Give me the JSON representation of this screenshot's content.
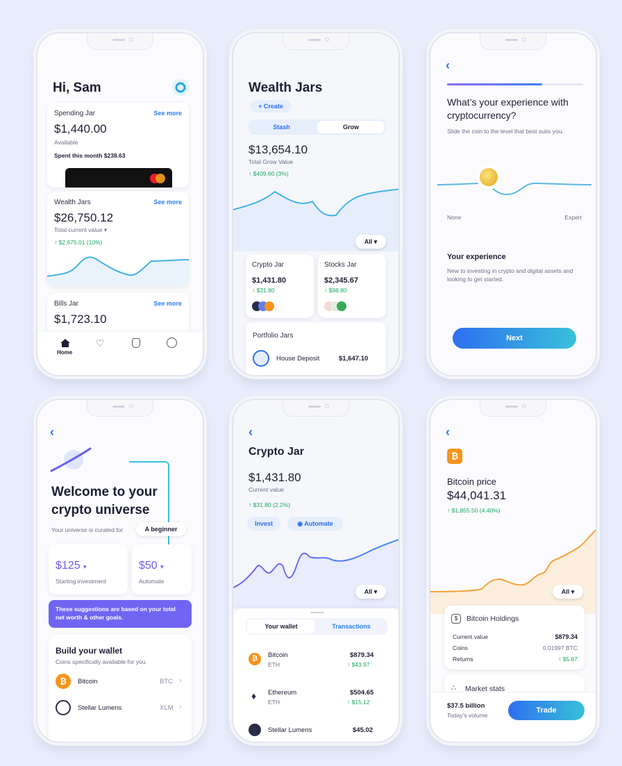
{
  "colors": {
    "accent": "#2b7ff0",
    "green": "#19a866",
    "orange": "#f7931a",
    "purple": "#6c5cf0",
    "teal": "#38c1d9",
    "bg": "#e9edfb"
  },
  "s1": {
    "greeting": "Hi, Sam",
    "spending": {
      "title": "Spending Jar",
      "link": "See more",
      "amount": "$1,440.00",
      "sub": "Available",
      "spent": "Spent this month $238.63"
    },
    "wealth": {
      "title": "Wealth Jars",
      "link": "See more",
      "amount": "$26,750.12",
      "sub": "Total current value",
      "change": "$2,675.01 (10%)"
    },
    "bills": {
      "title": "Bills Jar",
      "link": "See more",
      "amount": "$1,723.10"
    },
    "nav": {
      "home": "Home"
    },
    "icons": {
      "profile": "profile-icon",
      "home": "home-icon",
      "heart": "heart-icon",
      "jar": "jar-icon",
      "user": "user-icon",
      "card": "mastercard-logo"
    }
  },
  "s2": {
    "title": "Wealth Jars",
    "create": "+ Create",
    "tabs": [
      "Stash",
      "Grow"
    ],
    "amount": "$13,654.10",
    "sub": "Total Grow Value",
    "change": "$409.60 (3%)",
    "filter": "All",
    "crypto": {
      "title": "Crypto Jar",
      "amount": "$1,431.80",
      "change": "$31.80"
    },
    "stocks": {
      "title": "Stocks Jar",
      "amount": "$2,345.67",
      "change": "$98.80"
    },
    "portfolio": {
      "title": "Portfolio Jars",
      "item": "House Deposit",
      "amount": "$1,647.10"
    }
  },
  "s3": {
    "question": "What’s your experience with cryptocurrency?",
    "hint": "Slide the coin to the level that best suits you.",
    "min": "None",
    "max": "Expert",
    "exp_title": "Your experience",
    "exp_desc": "New to investing in crypto and digital assets and looking to get started.",
    "next": "Next",
    "level": 0.5,
    "progress": 0.7
  },
  "s4": {
    "title": "Welcome to your crypto universe",
    "curated": "Your universe is curated for",
    "level": "A beginner",
    "invest": {
      "amount": "$125",
      "label": "Starting investment"
    },
    "automate": {
      "amount": "$50",
      "label": "Automate"
    },
    "note": "These suggestions are based on your total net worth & other goals.",
    "build": {
      "title": "Build your wallet",
      "sub": "Coins specifically available for you."
    },
    "coins": [
      {
        "name": "Bitcoin",
        "sym": "BTC"
      },
      {
        "name": "Stellar Lumens",
        "sym": "XLM"
      }
    ]
  },
  "s5": {
    "title": "Crypto Jar",
    "amount": "$1,431.80",
    "sub": "Current value",
    "change": "$31.80 (2.2%)",
    "invest": "Invest",
    "automate": "Automate",
    "filter": "All",
    "tabs": [
      "Your wallet",
      "Transactions"
    ],
    "coins": [
      {
        "name": "Bitcoin",
        "sym": "ETH",
        "amount": "$879.34",
        "change": "$43.97"
      },
      {
        "name": "Ethereum",
        "sym": "ETH",
        "amount": "$504.65",
        "change": "$15.12"
      },
      {
        "name": "Stellar Lumens",
        "sym": "",
        "amount": "$45.02",
        "change": ""
      }
    ]
  },
  "s6": {
    "title": "Bitcoin price",
    "amount": "$44,041.31",
    "change": "$1,855.50 (4.40%)",
    "filter": "All",
    "holdings": {
      "title": "Bitcoin Holdings",
      "rows": [
        [
          "Current value",
          "$879.34"
        ],
        [
          "Coins",
          "0.01997 BTC"
        ],
        [
          "Returns",
          "$5.67"
        ]
      ]
    },
    "stats": "Market stats",
    "volume": "$37.5 billion",
    "volume_label": "Today’s volume",
    "trade": "Trade"
  }
}
